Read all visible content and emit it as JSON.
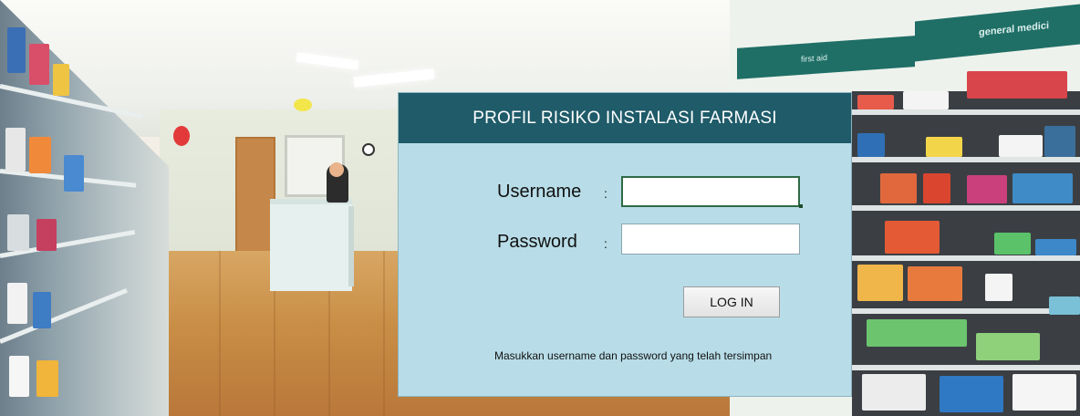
{
  "background": {
    "signs": {
      "left_sign": "first aid",
      "right_sign": "general medici"
    }
  },
  "login": {
    "title": "PROFIL RISIKO INSTALASI FARMASI",
    "username_label": "Username",
    "username_colon": ":",
    "username_value": "",
    "password_label": "Password",
    "password_colon": ":",
    "password_value": "",
    "login_button": "LOG IN",
    "hint": "Masukkan username dan password yang telah tersimpan"
  },
  "colors": {
    "header_bg": "#1f5b69",
    "dialog_bg": "#b8dde8",
    "sign_bg": "#1f6f66"
  }
}
